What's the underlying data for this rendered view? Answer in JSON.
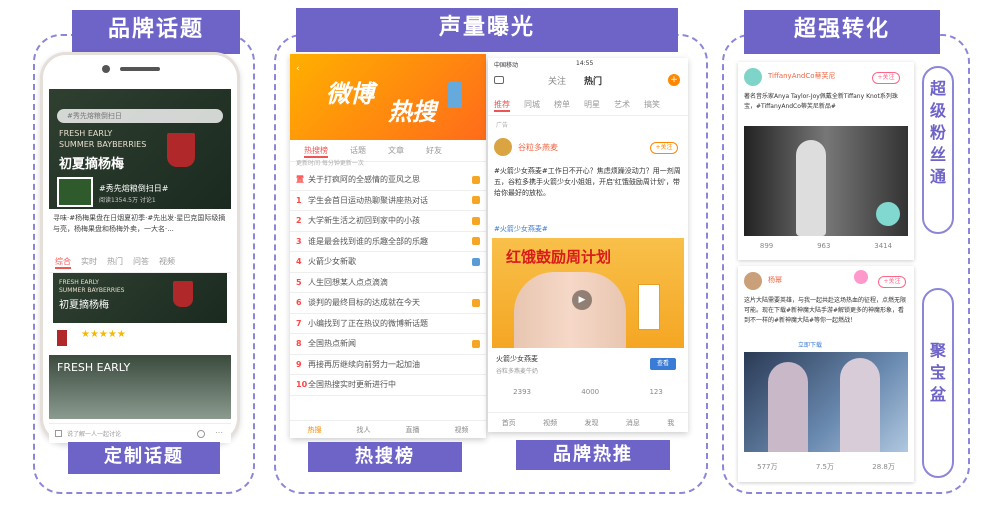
{
  "section1": {
    "header": "品牌话题",
    "footer": "定制话题",
    "screen": {
      "search_placeholder": "#秀先熔粮倒扫日",
      "banner_text": [
        "FRESH EARLY",
        "SUMMER BAYBERRIES"
      ],
      "banner_title": "初夏摘杨梅",
      "topic_tag": "#秀先熔粮倒扫日#",
      "stats": "阅读1354.5万 讨论1",
      "desc": "寻味·#杨梅果盘在日烟夏初季·#先出发·星巴克国际级摘与亮，杨梅果盘和杨梅外卖，一大名·...",
      "tabs": [
        "综合",
        "实时",
        "热门",
        "问答",
        "视频"
      ],
      "card2_text": [
        "FRESH EARLY",
        "SUMMER BAYBERRIES"
      ],
      "card2_title": "初夏摘杨梅",
      "rating": "★★★★★",
      "card3_text": "FRESH EARLY",
      "comment_placeholder": "说了解一人一起讨论"
    }
  },
  "section2": {
    "header": "声量曝光",
    "footer_left": "热搜榜",
    "footer_right": "品牌热推",
    "hot": {
      "banner_top": "微博",
      "banner_bottom": "热搜",
      "tabs": [
        "热搜榜",
        "话题",
        "文章",
        "好友"
      ],
      "subtitle": "更新时间·每分钟更新一次",
      "rows": [
        {
          "rank": "置",
          "text": "关于打疯阿的全感情的亚风之思"
        },
        {
          "rank": "1",
          "text": "学生会首日运动热聊聚讲座热对话"
        },
        {
          "rank": "2",
          "text": "大学新生活之初回到家中的小孩"
        },
        {
          "rank": "3",
          "text": "谁是最会找到谁的乐趣全部的乐趣"
        },
        {
          "rank": "4",
          "text": "火箭少女新歌"
        },
        {
          "rank": "5",
          "text": "人生回想某人点点滴滴"
        },
        {
          "rank": "6",
          "text": "谈判的最终目标的达成就在今天"
        },
        {
          "rank": "7",
          "text": "小编找到了正在热议的微博新话题"
        },
        {
          "rank": "8",
          "text": "全国热点新闻"
        },
        {
          "rank": "9",
          "text": "再接再厉继续向前努力一起加油"
        },
        {
          "rank": "10",
          "text": "全国热搜实时更新进行中"
        }
      ],
      "bottom_nav": [
        "热搜",
        "找人",
        "直播",
        "视频"
      ]
    },
    "feed": {
      "status_left": "中国移动",
      "status_time": "14:55",
      "top_tabs": [
        "关注",
        "热门"
      ],
      "sub_tabs": [
        "推荐",
        "同城",
        "榜单",
        "明星",
        "艺术",
        "搞笑"
      ],
      "ad_label": "广告",
      "account": "谷粒多燕麦",
      "follow": "+关注",
      "post": "#火箭少女燕麦#工作日不开心？焦虑烦躁没动力？用一剂周五，谷粒多携手火箭少女小姐姐，开启'红饿鼓励周计划'，带给你最好的放松。",
      "post_tail": "#火箭少女燕麦#",
      "ad_title": "红饿鼓励周计划",
      "card_title": "火箭少女燕麦",
      "card_sub": "谷粒多燕麦牛奶",
      "card_btn": "查看",
      "counts": [
        "2393",
        "4000",
        "123"
      ],
      "bottom_nav": [
        "首页",
        "视频",
        "发现",
        "消息",
        "我"
      ]
    }
  },
  "section3": {
    "header": "超强转化",
    "label1": "超级粉丝通",
    "label2": "聚宝盆",
    "card1": {
      "name": "TiffanyAndCo蒂芙尼",
      "follow": "+关注",
      "text": "著名音乐家Anya Taylor-Joy佩戴全新Tiffany Knot系列珠宝，#TiffanyAndCo蒂芙尼新品#",
      "stats": [
        "899",
        "963",
        "3414"
      ]
    },
    "card2": {
      "name": "杨幂",
      "follow": "+关注",
      "text": "这片大陆需要英雄，与我一起共赴这场热血的征程，点燃无限可能。现在下载#新神魔大陆手游#解锁更多的神魔形象，看到不一样的#新神魔大陆#等你一起燃战！",
      "link": "立即下载",
      "stats": [
        "577万",
        "7.5万",
        "28.8万"
      ]
    }
  }
}
